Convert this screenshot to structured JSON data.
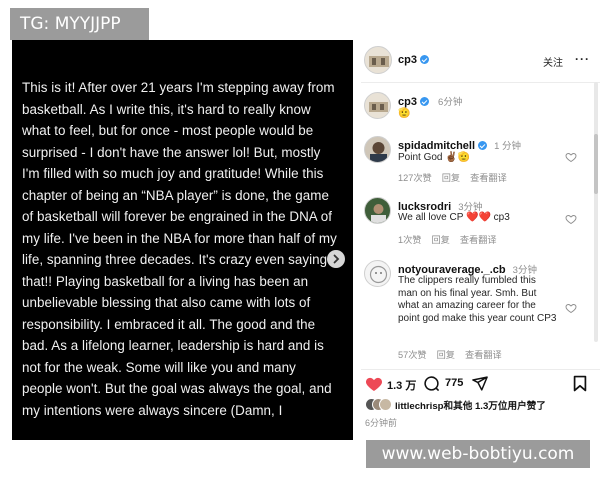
{
  "watermark_tag": "TG: MYYJJPP",
  "watermark_url": "www.web-bobtiyu.com",
  "post_text": "This is it! After over 21 years I'm stepping away from basketball.  As I write this, it's hard to really know what to feel, but for once - most people would be surprised - I don't have the answer lol! But, mostly I'm filled with so much  joy and gratitude! While this chapter of being an “NBA player” is done, the game of basketball will forever be engrained in the DNA of my life. I've been in the NBA for more than half of my life, spanning three decades. It's crazy even saying that!! Playing basketball for a living has been an unbelievable blessing that also came with lots of responsibility.  I embraced it all. The good and the bad. As a lifelong learner, leadership is hard and is not for the weak. Some will like you and many people won't. But the goal was always the goal, and my intentions were always sincere (Damn, I",
  "header": {
    "username": "cp3",
    "follow_label": "关注",
    "more_icon": "more-dots-icon"
  },
  "caption": {
    "username": "cp3",
    "time": "6分钟",
    "text": "🫡"
  },
  "comments": [
    {
      "username": "spidadmitchell",
      "verified": true,
      "time": "1 分钟",
      "text": "Point God ✌🏾🫡",
      "likes": "127次赞",
      "reply": "回复",
      "translate": "查看翻译"
    },
    {
      "username": "lucksrodri",
      "verified": false,
      "time": "3分钟",
      "text": "We all love CP ❤️❤️ cp3",
      "likes": "1次赞",
      "reply": "回复",
      "translate": "查看翻译"
    },
    {
      "username": "notyouraverage._.cb",
      "verified": false,
      "time": "3分钟",
      "text": "The clippers really fumbled this man on his final year. Smh. But what an amazing career for the point god make this year count CP3",
      "likes": "57次赞",
      "reply": "回复",
      "translate": "查看翻译"
    }
  ],
  "actions": {
    "likes_count": "1.3 万",
    "comments_count": "775"
  },
  "liked_by": {
    "user": "littlechrisp",
    "rest": "和其他 1.3万位用户赞了"
  },
  "post_time": "6分钟前",
  "colors": {
    "accent_blue": "#3897f0",
    "like_red": "#ed4956",
    "panel_bg": "#ffffff",
    "post_bg": "#000000"
  }
}
